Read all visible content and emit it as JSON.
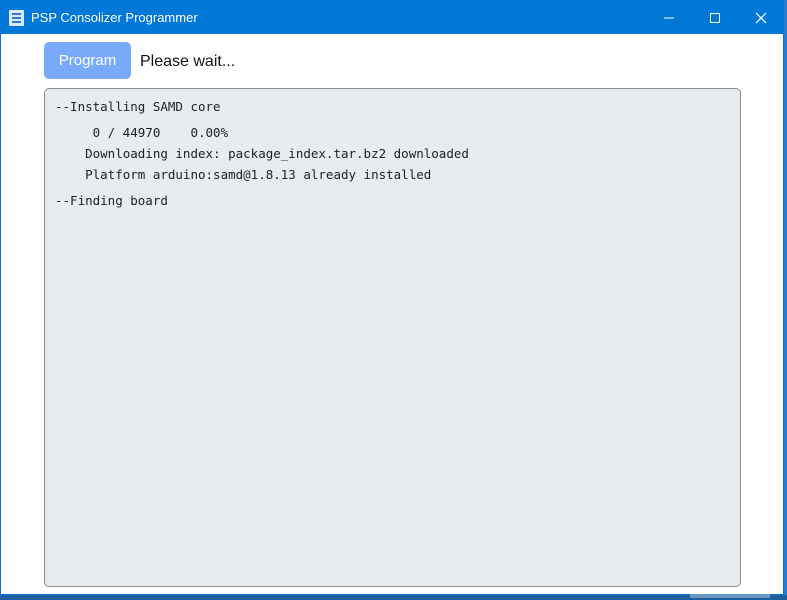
{
  "window": {
    "title": "PSP Consolizer Programmer",
    "app_icon": "programmer-app-icon",
    "controls": {
      "minimize_icon": "minimize-icon",
      "maximize_icon": "maximize-icon",
      "close_icon": "close-icon"
    }
  },
  "toolbar": {
    "program_label": "Program",
    "status": "Please wait..."
  },
  "console": {
    "lines": [
      "--Installing SAMD core",
      "     0 / 44970    0.00%",
      "    Downloading index: package_index.tar.bz2 downloaded",
      "    Platform arduino:samd@1.8.13 already installed",
      "--Finding board"
    ]
  },
  "colors": {
    "titlebar": "#0078d7",
    "program_button": "#78aaf9",
    "console_background": "#e9ecef"
  }
}
